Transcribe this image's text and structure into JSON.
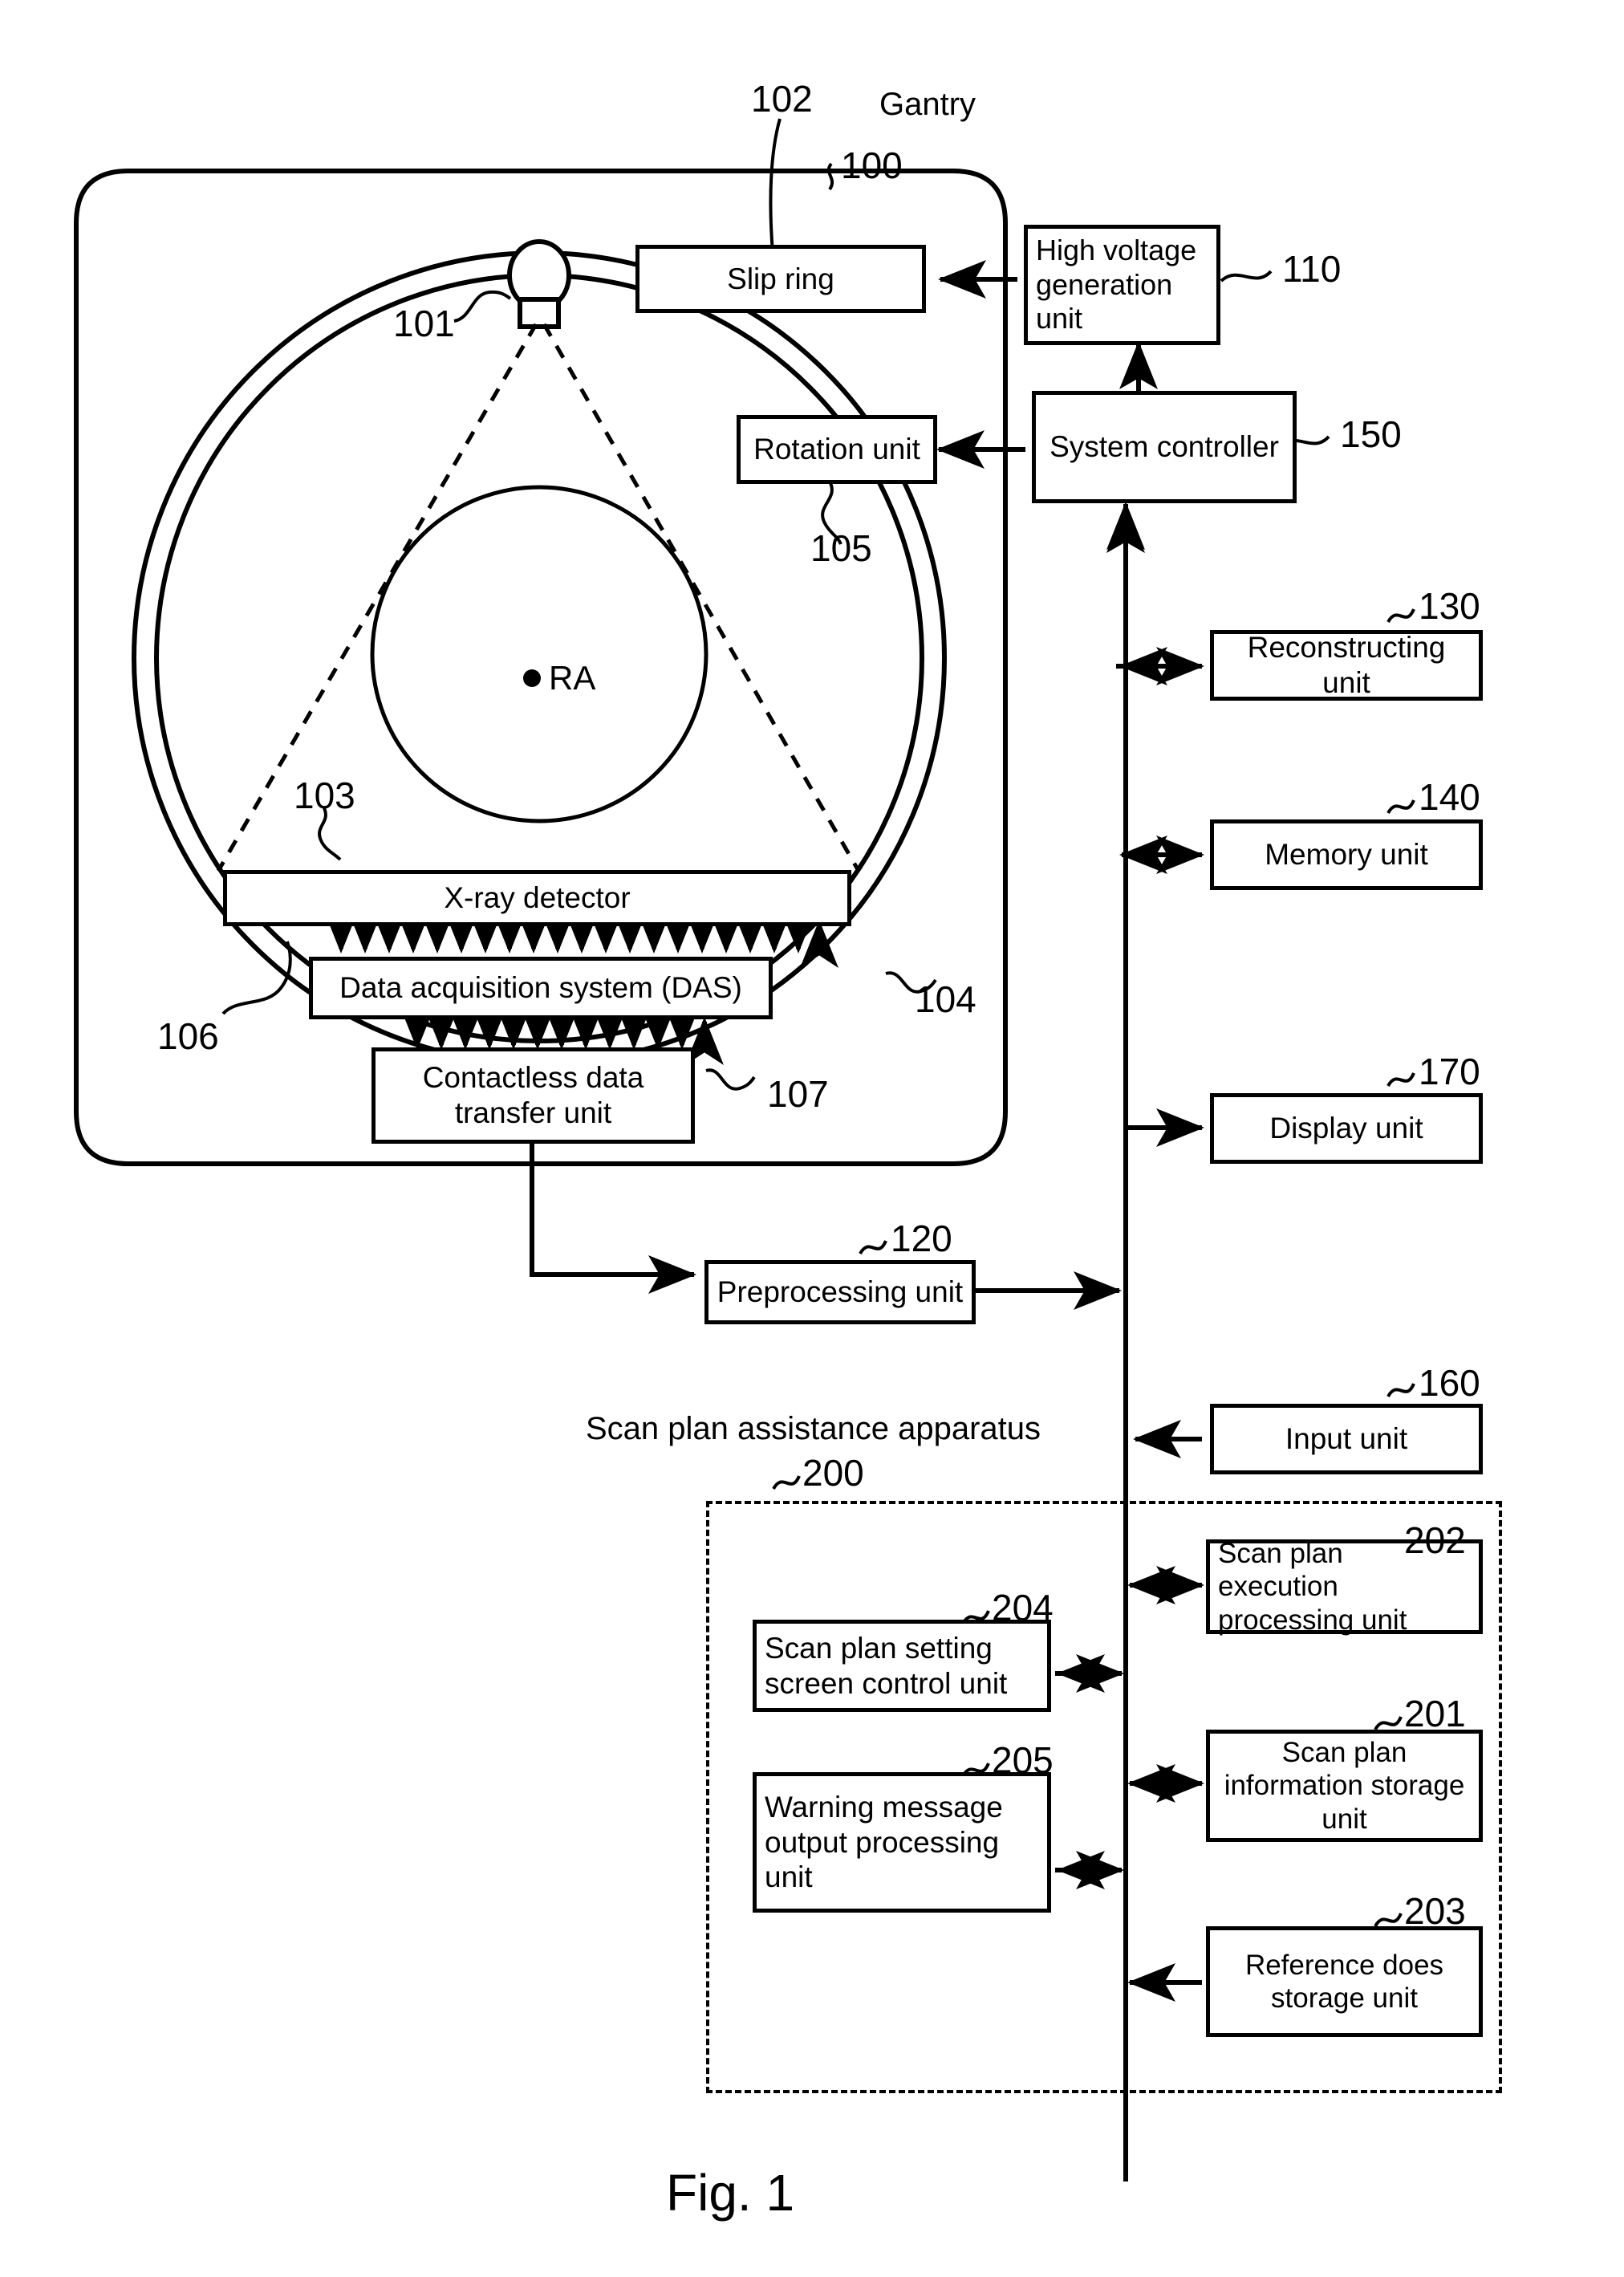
{
  "figure": {
    "caption": "Fig. 1",
    "gantry_label": "Gantry",
    "apparatus_label": "Scan plan assistance apparatus",
    "center_label": "RA"
  },
  "boxes": [
    {
      "id": "slip-ring",
      "label": "Slip ring",
      "ref": ""
    },
    {
      "id": "high-voltage",
      "label": "High voltage generation unit",
      "ref": "110"
    },
    {
      "id": "rotation",
      "label": "Rotation unit",
      "ref": "105"
    },
    {
      "id": "system-controller",
      "label": "System controller",
      "ref": "150"
    },
    {
      "id": "reconstructing",
      "label": "Reconstructing unit",
      "ref": "130"
    },
    {
      "id": "memory",
      "label": "Memory unit",
      "ref": "140"
    },
    {
      "id": "display",
      "label": "Display unit",
      "ref": "170"
    },
    {
      "id": "input",
      "label": "Input unit",
      "ref": "160"
    },
    {
      "id": "xray-detector",
      "label": "X-ray detector",
      "ref": "103"
    },
    {
      "id": "das",
      "label": "Data acquisition system (DAS)",
      "ref": "106"
    },
    {
      "id": "contactless",
      "label": "Contactless data transfer unit",
      "ref": "107"
    },
    {
      "id": "preprocessing",
      "label": "Preprocessing unit",
      "ref": "120"
    },
    {
      "id": "scan-plan-setting",
      "label": "Scan plan setting screen control unit",
      "ref": "204"
    },
    {
      "id": "warning-message",
      "label": "Warning message output processing unit",
      "ref": "205"
    },
    {
      "id": "scan-plan-exec",
      "label": "Scan plan execution processing unit",
      "ref": "202"
    },
    {
      "id": "scan-plan-info",
      "label": "Scan plan information storage unit",
      "ref": "201"
    },
    {
      "id": "reference-dose",
      "label": "Reference does storage unit",
      "ref": "203"
    }
  ],
  "box_labels": {
    "slip_ring": "Slip ring",
    "high_voltage": "High voltage generation unit",
    "rotation": "Rotation unit",
    "system_controller": "System controller",
    "reconstructing": "Reconstructing unit",
    "memory": "Memory unit",
    "display": "Display unit",
    "input": "Input unit",
    "xray_detector": "X-ray detector",
    "das": "Data acquisition system (DAS)",
    "contactless": "Contactless data transfer unit",
    "preprocessing": "Preprocessing unit",
    "scan_plan_setting": "Scan plan setting screen control unit",
    "warning_message": "Warning message output processing unit",
    "scan_plan_exec": "Scan plan execution processing unit",
    "scan_plan_info": "Scan plan information storage unit",
    "reference_dose": "Reference does storage unit"
  },
  "reference_numerals": {
    "n100": "100",
    "n101": "101",
    "n102": "102",
    "n103": "103",
    "n104": "104",
    "n105": "105",
    "n106": "106",
    "n107": "107",
    "n110": "110",
    "n120": "120",
    "n130": "130",
    "n140": "140",
    "n150": "150",
    "n160": "160",
    "n170": "170",
    "n200": "200",
    "n201": "201",
    "n202": "202",
    "n203": "203",
    "n204": "204",
    "n205": "205"
  },
  "colors": {
    "line": "#000000",
    "background": "#ffffff"
  }
}
